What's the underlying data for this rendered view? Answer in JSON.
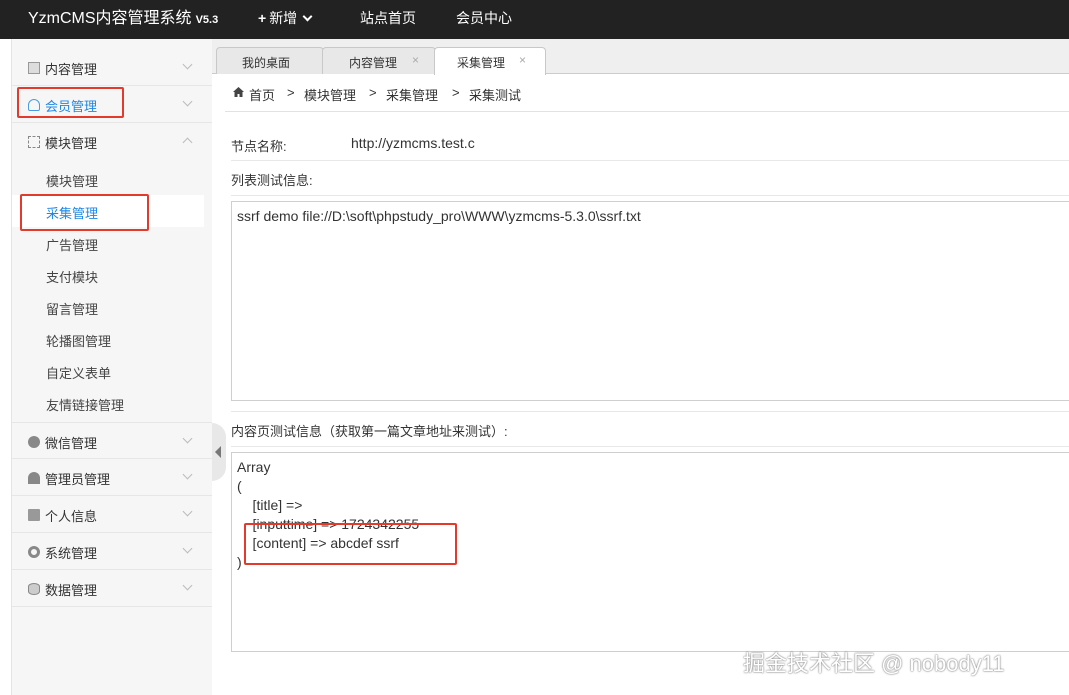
{
  "topbar": {
    "brand": "YzmCMS内容管理系统",
    "version": "V5.3",
    "add_label": "新增",
    "add_plus": "+",
    "site_home": "站点首页",
    "member_center": "会员中心"
  },
  "sidebar": {
    "menus": [
      {
        "label": "内容管理",
        "icon": "content-icon"
      },
      {
        "label": "会员管理",
        "icon": "user-icon"
      },
      {
        "label": "模块管理",
        "icon": "grid-icon"
      },
      {
        "label": "微信管理",
        "icon": "wechat-icon"
      },
      {
        "label": "管理员管理",
        "icon": "admin-icon"
      },
      {
        "label": "个人信息",
        "icon": "card-icon"
      },
      {
        "label": "系统管理",
        "icon": "gear-icon"
      },
      {
        "label": "数据管理",
        "icon": "database-icon"
      }
    ],
    "module_subitems": [
      "模块管理",
      "采集管理",
      "广告管理",
      "支付模块",
      "留言管理",
      "轮播图管理",
      "自定义表单",
      "友情链接管理"
    ],
    "active_subitem": "采集管理"
  },
  "tabs": [
    {
      "label": "我的桌面",
      "closable": false
    },
    {
      "label": "内容管理",
      "closable": true,
      "close": "×"
    },
    {
      "label": "采集管理",
      "closable": true,
      "close": "×",
      "active": true
    }
  ],
  "breadcrumb": {
    "items": [
      "首页",
      "模块管理",
      "采集管理",
      "采集测试"
    ],
    "separator": ">"
  },
  "main": {
    "node_name_label": "节点名称:",
    "node_name_value": "http://yzmcms.test.c",
    "list_test_label": "列表测试信息:",
    "list_test_output": "ssrf demo file://D:\\soft\\phpstudy_pro\\WWW\\yzmcms-5.3.0\\ssrf.txt",
    "content_test_label": "内容页测试信息（获取第一篇文章地址来测试）:",
    "content_test_lines": [
      "Array",
      "(",
      "    [title] =>",
      "    [inputtime] => 1724342255",
      "    [content] => abcdef ssrf",
      ")"
    ]
  },
  "watermark": "掘金技术社区 @ nobody11",
  "colors": {
    "topbar": "#222222",
    "sidebar": "#f6f6f6",
    "highlight_box": "#e23b2e",
    "active_link": "#1e88e5"
  }
}
